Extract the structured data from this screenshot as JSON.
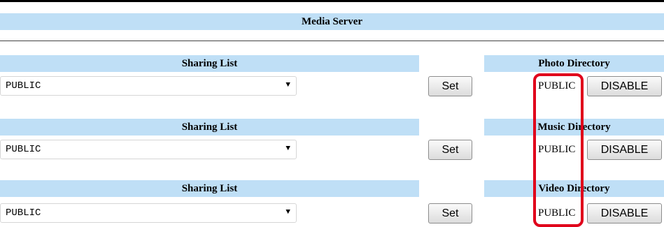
{
  "section": {
    "title": "Media Server"
  },
  "rows": [
    {
      "sharing_label": "Sharing List",
      "selected": "PUBLIC",
      "set_label": "Set",
      "directory_label": "Photo Directory",
      "directory_value": "PUBLIC",
      "disable_label": "DISABLE"
    },
    {
      "sharing_label": "Sharing List",
      "selected": "PUBLIC",
      "set_label": "Set",
      "directory_label": "Music Directory",
      "directory_value": "PUBLIC",
      "disable_label": "DISABLE"
    },
    {
      "sharing_label": "Sharing List",
      "selected": "PUBLIC",
      "set_label": "Set",
      "directory_label": "Video Directory",
      "directory_value": "PUBLIC",
      "disable_label": "DISABLE"
    }
  ],
  "colors": {
    "header_bg": "#bfdff6",
    "highlight": "#e0001b"
  },
  "icons": {
    "dropdown": "chevron-down-icon"
  }
}
